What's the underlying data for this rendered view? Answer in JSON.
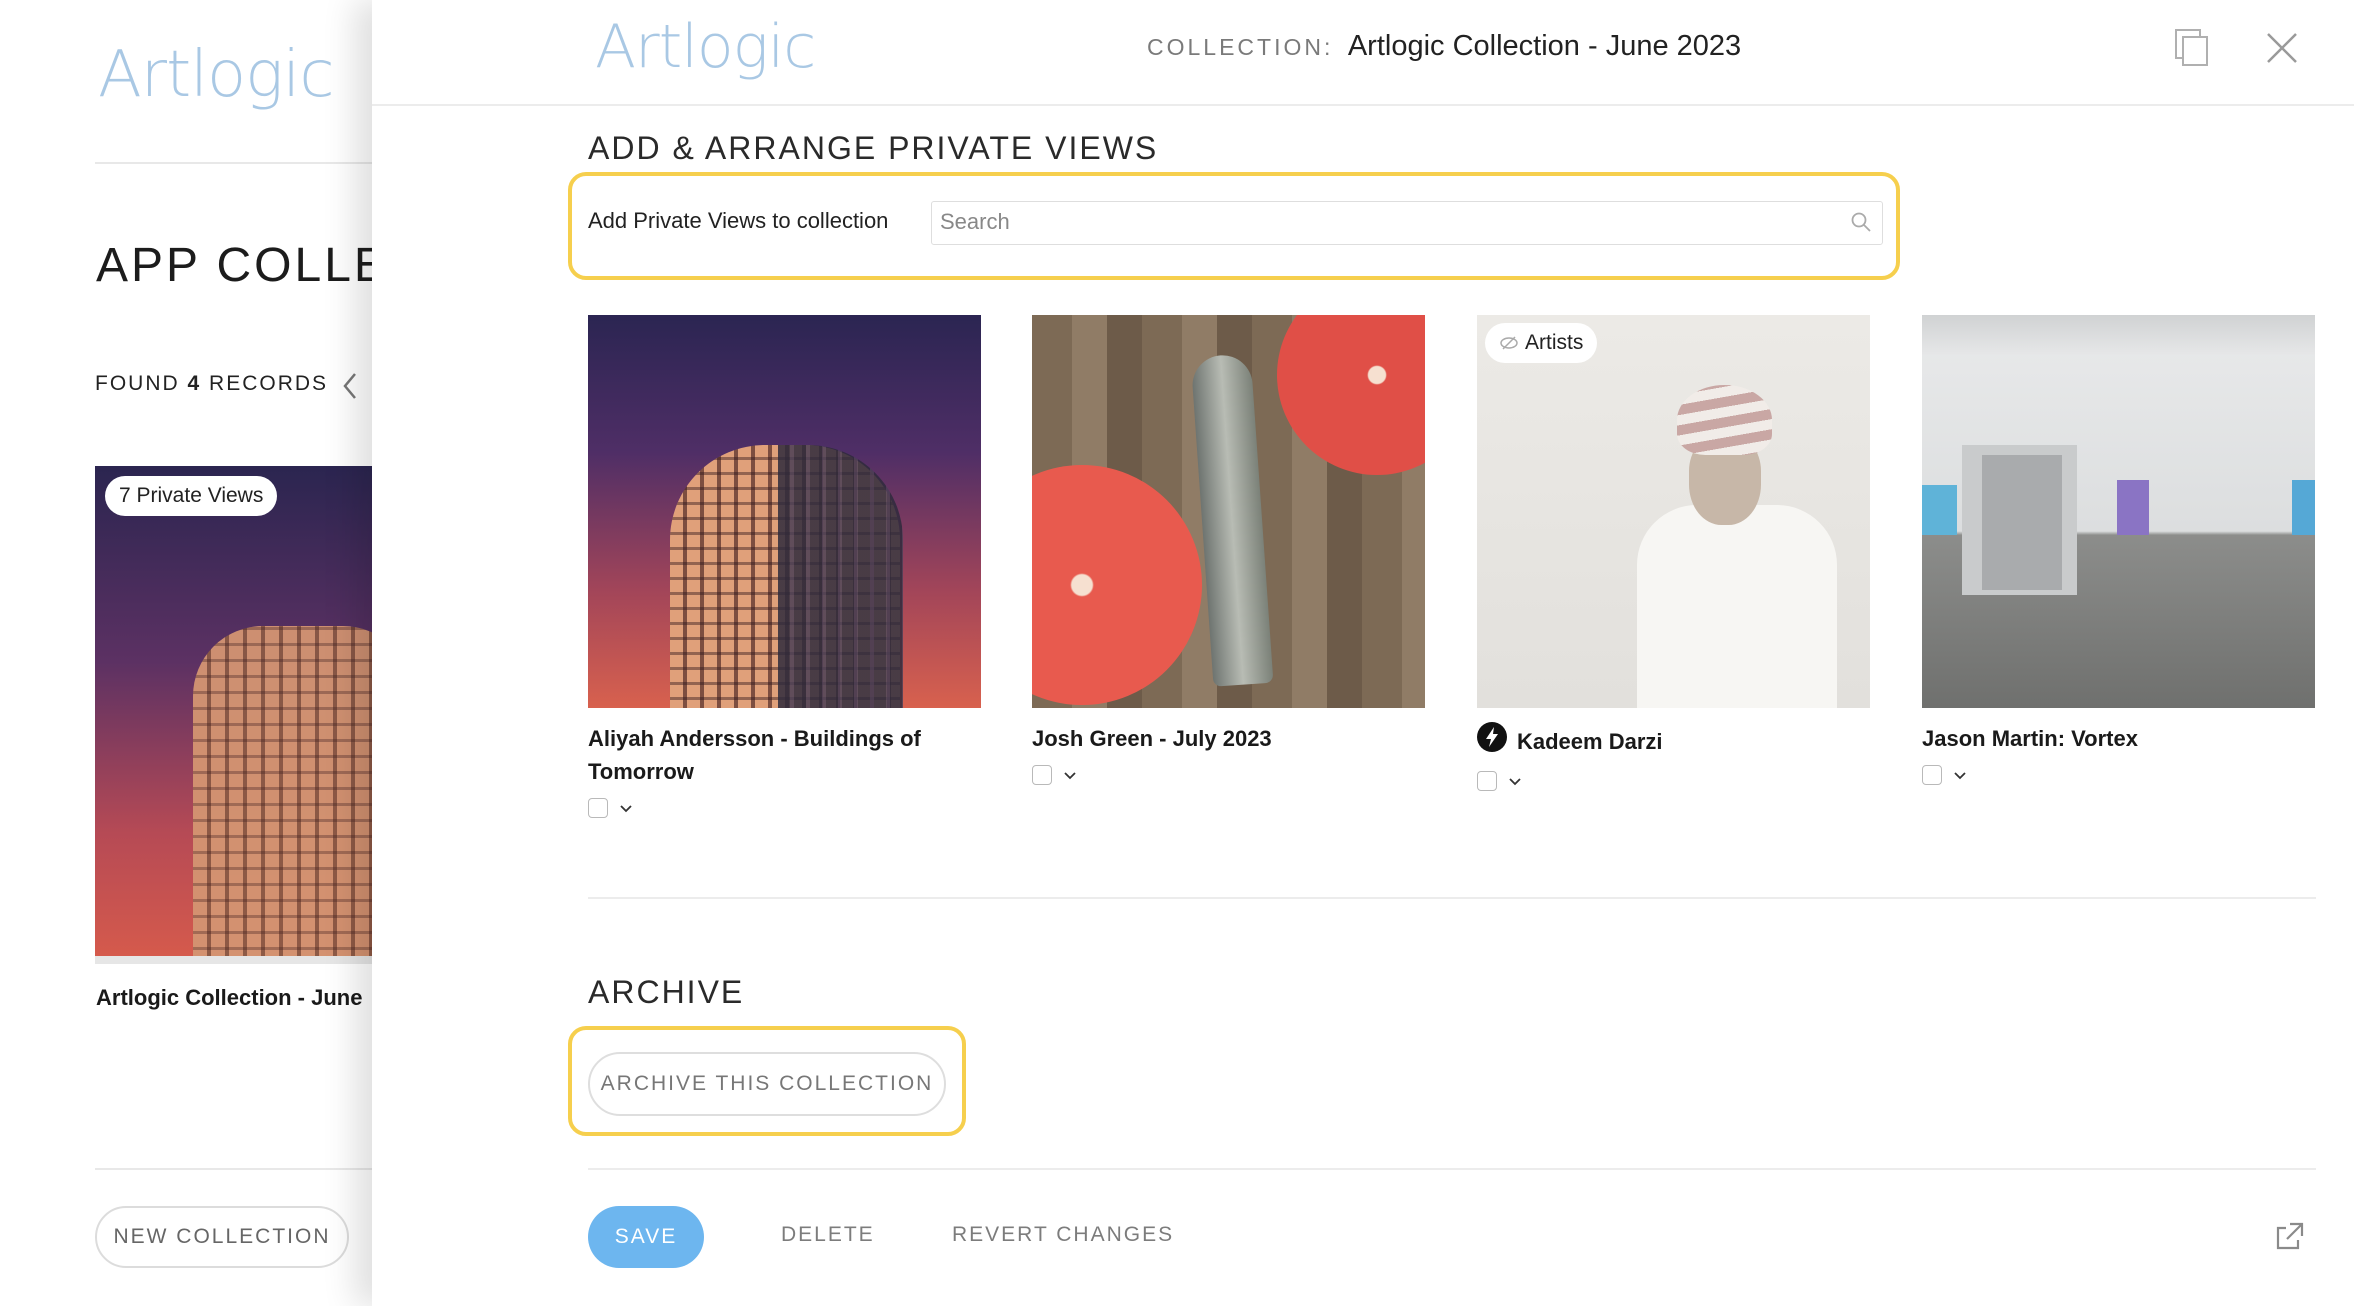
{
  "brand": {
    "logo_text": "Artlogic",
    "accent_color": "#a9c8e4"
  },
  "background_page": {
    "title": "APP COLLEC",
    "found_prefix": "FOUND",
    "found_count": "4",
    "found_suffix": "RECORDS",
    "card_badge": "7 Private Views",
    "card_title": "Artlogic Collection - June",
    "new_collection_label": "NEW COLLECTION"
  },
  "header": {
    "collection_key": "COLLECTION:",
    "collection_name": "Artlogic Collection - June 2023",
    "icons": [
      "copy-icon",
      "close-icon"
    ]
  },
  "add_section": {
    "title": "ADD & ARRANGE PRIVATE VIEWS",
    "add_label": "Add Private Views to collection",
    "search_placeholder": "Search",
    "highlight_color": "#f6cf4d"
  },
  "private_views": [
    {
      "title": "Aliyah Andersson - Buildings of Tomorrow",
      "badge": "",
      "icon": ""
    },
    {
      "title": "Josh Green - July 2023",
      "badge": "",
      "icon": ""
    },
    {
      "title": "Kadeem Darzi",
      "badge": "Artists",
      "icon": "lightning-icon"
    },
    {
      "title": "Jason Martin: Vortex",
      "badge": "",
      "icon": ""
    }
  ],
  "archive_section": {
    "title": "ARCHIVE",
    "button_label": "ARCHIVE THIS COLLECTION"
  },
  "footer": {
    "save_label": "SAVE",
    "delete_label": "DELETE",
    "revert_label": "REVERT CHANGES",
    "save_color": "#6db6ef",
    "external_icon": "external-link-icon"
  }
}
